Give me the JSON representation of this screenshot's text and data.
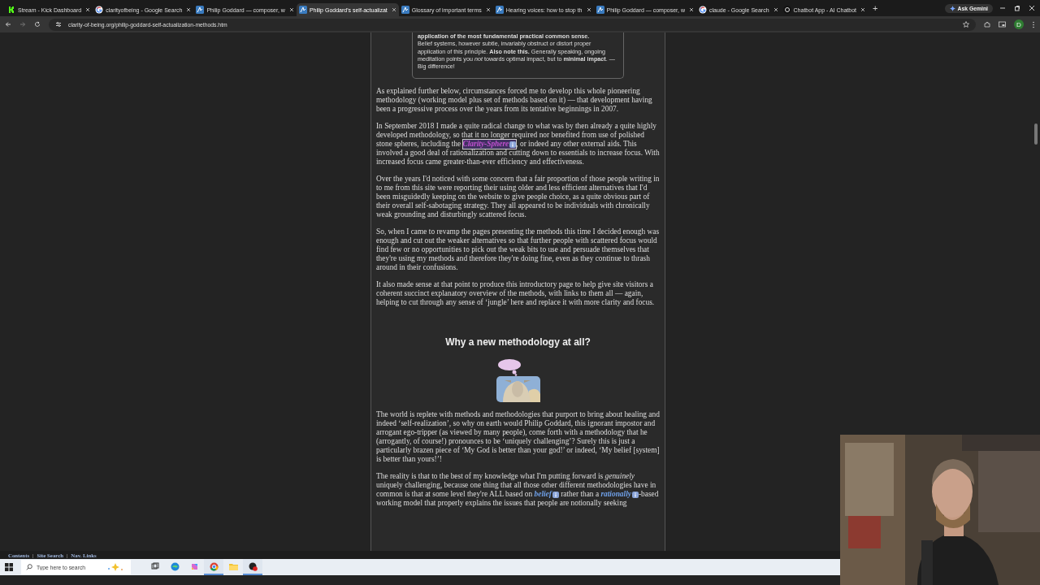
{
  "browser": {
    "tabs": [
      {
        "title": "Stream - Kick Dashboard",
        "kind": "kick",
        "selected": false
      },
      {
        "title": "clarityofbeing - Google Search",
        "kind": "google",
        "selected": false
      },
      {
        "title": "Philip Goddard — composer, w",
        "kind": "site",
        "selected": false
      },
      {
        "title": "Philip Goddard's self-actualizat",
        "kind": "site",
        "selected": true
      },
      {
        "title": "Glossary of important terms",
        "kind": "site",
        "selected": false
      },
      {
        "title": "Hearing voices: how to stop th",
        "kind": "site",
        "selected": false
      },
      {
        "title": "Philip Goddard — composer, w",
        "kind": "site",
        "selected": false
      },
      {
        "title": "claude - Google Search",
        "kind": "google",
        "selected": false
      },
      {
        "title": "Chatbot App - AI Chatbot",
        "kind": "chat",
        "selected": false
      }
    ],
    "new_tab": "+",
    "ask_gemini": "Ask Gemini",
    "address": "clarity-of-being.org/philip-goddard-self-actualization-methods.htm",
    "profile": "D"
  },
  "article": {
    "callout": {
      "lead": "application of the most fundamental practical common sense.",
      "text": "Belief systems, however subtle, invariably obstruct or distort proper application of this principle. **Also note this.** Generally speaking, ongoing meditation points you *not* towards optimal impact, but to **minimal impact**. — Big difference!"
    },
    "blocks": [
      {
        "kind": "paragraph",
        "parts": [
          {
            "kind": "text",
            "text": "As explained further below, circumstances forced me to develop this whole pioneering methodology (working model plus set of methods based on it) — that development having been a progressive process over the years from its tentative beginnings in 2007."
          }
        ]
      },
      {
        "kind": "paragraph",
        "parts": [
          {
            "kind": "text",
            "text": "In September 2018 I made a quite radical change to what was by then already a quite highly developed methodology, so that it no longer required nor benefited from use of polished stone spheres, including the "
          },
          {
            "kind": "link",
            "text": "Clarity-Sphere",
            "visited": true,
            "focused": true
          },
          {
            "kind": "text",
            "text": ", or indeed any other external aids. This involved a good deal of rationalization and cutting down to essentials to increase focus. With increased focus came greater-than-ever efficiency and effectiveness."
          }
        ]
      },
      {
        "kind": "paragraph",
        "parts": [
          {
            "kind": "text",
            "text": "Over the years I'd noticed with some concern that a fair proportion of those people writing in to me from this site were reporting their using older and less efficient alternatives that I'd been misguidedly keeping on the website to give people choice, as a quite obvious part of their overall self-sabotaging strategy. They all appeared to be individuals with chronically weak grounding and disturbingly scattered focus."
          }
        ]
      },
      {
        "kind": "paragraph",
        "parts": [
          {
            "kind": "text",
            "text": "So, when I came to revamp the pages presenting the methods this time I decided enough was enough and cut out the weaker alternatives so that further people with scattered focus would find few or no opportunities to pick out the weak bits to use and persuade themselves that they're using my methods and therefore they're doing fine, even as they continue to thrash around in their confusions."
          }
        ]
      },
      {
        "kind": "paragraph",
        "parts": [
          {
            "kind": "text",
            "text": "It also made sense at that point to produce this introductory page to help give site visitors a coherent succinct explanatory overview of the methods, with links to them all — again, helping to cut through any sense of ‘jungle’ here and replace it with more clarity and focus."
          }
        ]
      },
      {
        "kind": "heading",
        "text": "Why a new methodology at all?"
      },
      {
        "kind": "picture"
      },
      {
        "kind": "paragraph",
        "parts": [
          {
            "kind": "text",
            "text": "The world is replete with methods and methodologies that purport to bring about healing and indeed ‘self-realization’, so why on earth would Philip Goddard, this ignorant impostor and arrogant ego-tripper (as viewed by many people), come forth with a methodology that he (arrogantly, of course!) pronounces to be ‘uniquely challenging’? Surely this is just a particularly brazen piece of ‘My God is better than your god!’ or indeed, ‘My belief [system] is better than yours!’!"
          }
        ]
      },
      {
        "kind": "paragraph",
        "parts": [
          {
            "kind": "text",
            "text": "The reality is that to the best of my knowledge what I'm putting forward is *genuinely* uniquely challenging, because one thing that all those other different methodologies have in common is that at some level they're ALL based on "
          },
          {
            "kind": "link",
            "text": "belief",
            "visited": false,
            "focused": false
          },
          {
            "kind": "text",
            "text": " rather than a "
          },
          {
            "kind": "link",
            "text": "rationally",
            "visited": false,
            "focused": false
          },
          {
            "kind": "text",
            "text": "-based working model that properly explains the issues that people are notionally seeking"
          }
        ]
      }
    ]
  },
  "footer_links": [
    {
      "kind": "link",
      "text": "Contents"
    },
    {
      "kind": "separator",
      "text": "|"
    },
    {
      "kind": "link",
      "text": "Site Search"
    },
    {
      "kind": "separator",
      "text": "|"
    },
    {
      "kind": "link",
      "text": "Nav. Links"
    }
  ],
  "taskbar": {
    "search_placeholder": "Type here to search",
    "apps": [
      {
        "kind": "taskview",
        "active": false
      },
      {
        "kind": "edge",
        "active": false
      },
      {
        "kind": "copilot",
        "active": false
      },
      {
        "kind": "chrome",
        "active": true
      },
      {
        "kind": "files",
        "active": false
      },
      {
        "kind": "recorder",
        "active": true
      }
    ]
  },
  "webcam": {
    "kind": "picture"
  }
}
